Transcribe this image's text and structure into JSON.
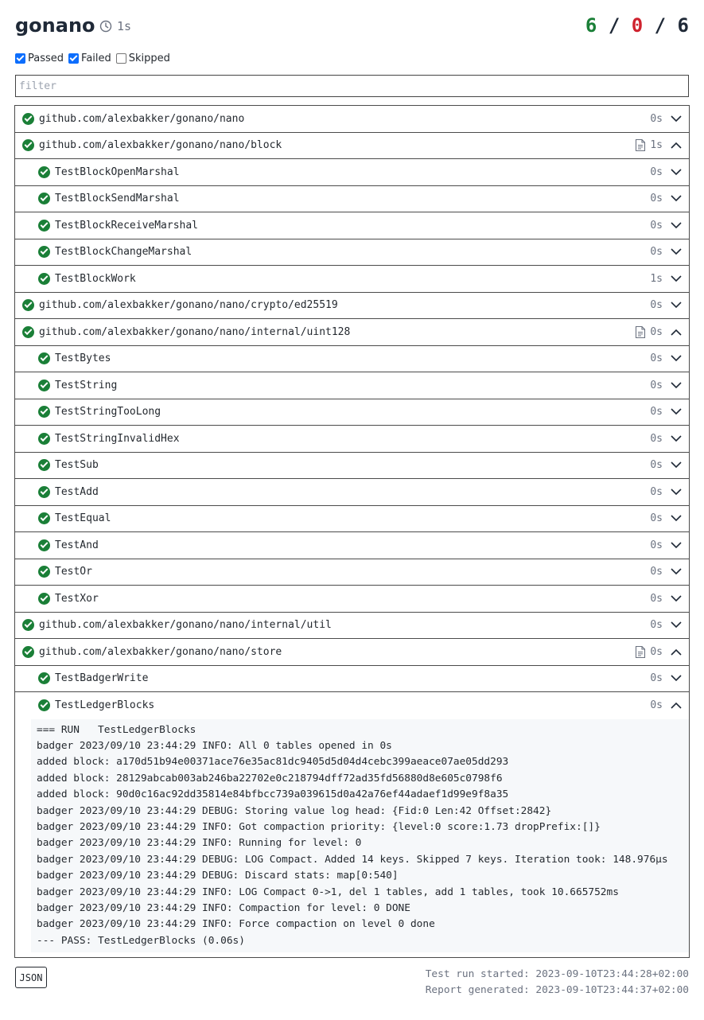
{
  "header": {
    "title": "gonano",
    "duration": "1s",
    "passed": "6",
    "failed": "0",
    "total": "6",
    "sep": "/"
  },
  "filters": {
    "passed_label": "Passed",
    "failed_label": "Failed",
    "skipped_label": "Skipped",
    "placeholder": "filter"
  },
  "rows": [
    {
      "kind": "pkg",
      "name": "github.com/alexbakker/gonano/nano",
      "dur": "0s",
      "expanded": false,
      "doc": false
    },
    {
      "kind": "pkg",
      "name": "github.com/alexbakker/gonano/nano/block",
      "dur": "1s",
      "expanded": true,
      "doc": true
    },
    {
      "kind": "test",
      "name": "TestBlockOpenMarshal",
      "dur": "0s",
      "expanded": false
    },
    {
      "kind": "test",
      "name": "TestBlockSendMarshal",
      "dur": "0s",
      "expanded": false
    },
    {
      "kind": "test",
      "name": "TestBlockReceiveMarshal",
      "dur": "0s",
      "expanded": false
    },
    {
      "kind": "test",
      "name": "TestBlockChangeMarshal",
      "dur": "0s",
      "expanded": false
    },
    {
      "kind": "test",
      "name": "TestBlockWork",
      "dur": "1s",
      "expanded": false
    },
    {
      "kind": "pkg",
      "name": "github.com/alexbakker/gonano/nano/crypto/ed25519",
      "dur": "0s",
      "expanded": false,
      "doc": false
    },
    {
      "kind": "pkg",
      "name": "github.com/alexbakker/gonano/nano/internal/uint128",
      "dur": "0s",
      "expanded": true,
      "doc": true
    },
    {
      "kind": "test",
      "name": "TestBytes",
      "dur": "0s",
      "expanded": false
    },
    {
      "kind": "test",
      "name": "TestString",
      "dur": "0s",
      "expanded": false
    },
    {
      "kind": "test",
      "name": "TestStringTooLong",
      "dur": "0s",
      "expanded": false
    },
    {
      "kind": "test",
      "name": "TestStringInvalidHex",
      "dur": "0s",
      "expanded": false
    },
    {
      "kind": "test",
      "name": "TestSub",
      "dur": "0s",
      "expanded": false
    },
    {
      "kind": "test",
      "name": "TestAdd",
      "dur": "0s",
      "expanded": false
    },
    {
      "kind": "test",
      "name": "TestEqual",
      "dur": "0s",
      "expanded": false
    },
    {
      "kind": "test",
      "name": "TestAnd",
      "dur": "0s",
      "expanded": false
    },
    {
      "kind": "test",
      "name": "TestOr",
      "dur": "0s",
      "expanded": false
    },
    {
      "kind": "test",
      "name": "TestXor",
      "dur": "0s",
      "expanded": false
    },
    {
      "kind": "pkg",
      "name": "github.com/alexbakker/gonano/nano/internal/util",
      "dur": "0s",
      "expanded": false,
      "doc": false
    },
    {
      "kind": "pkg",
      "name": "github.com/alexbakker/gonano/nano/store",
      "dur": "0s",
      "expanded": true,
      "doc": true
    },
    {
      "kind": "test",
      "name": "TestBadgerWrite",
      "dur": "0s",
      "expanded": false
    },
    {
      "kind": "test",
      "name": "TestLedgerBlocks",
      "dur": "0s",
      "expanded": true
    }
  ],
  "output": [
    "=== RUN   TestLedgerBlocks",
    "badger 2023/09/10 23:44:29 INFO: All 0 tables opened in 0s",
    "added block: a170d51b94e00371ace76e35ac81dc9405d5d04d4cebc399aeace07ae05dd293",
    "added block: 28129abcab003ab246ba22702e0c218794dff72ad35fd56880d8e605c0798f6",
    "added block: 90d0c16ac92dd35814e84bfbcc739a039615d0a42a76ef44adaef1d99e9f8a35",
    "badger 2023/09/10 23:44:29 DEBUG: Storing value log head: {Fid:0 Len:42 Offset:2842}",
    "badger 2023/09/10 23:44:29 INFO: Got compaction priority: {level:0 score:1.73 dropPrefix:[]}",
    "badger 2023/09/10 23:44:29 INFO: Running for level: 0",
    "badger 2023/09/10 23:44:29 DEBUG: LOG Compact. Added 14 keys. Skipped 7 keys. Iteration took: 148.976µs",
    "badger 2023/09/10 23:44:29 DEBUG: Discard stats: map[0:540]",
    "badger 2023/09/10 23:44:29 INFO: LOG Compact 0->1, del 1 tables, add 1 tables, took 10.665752ms",
    "badger 2023/09/10 23:44:29 INFO: Compaction for level: 0 DONE",
    "badger 2023/09/10 23:44:29 INFO: Force compaction on level 0 done",
    "--- PASS: TestLedgerBlocks (0.06s)"
  ],
  "footer": {
    "json_label": "JSON",
    "started": "Test run started: 2023-09-10T23:44:28+02:00",
    "generated": "Report generated: 2023-09-10T23:44:37+02:00"
  },
  "colors": {
    "pass": "#1a7f37",
    "fail": "#cf222e",
    "muted": "#6b7280"
  }
}
